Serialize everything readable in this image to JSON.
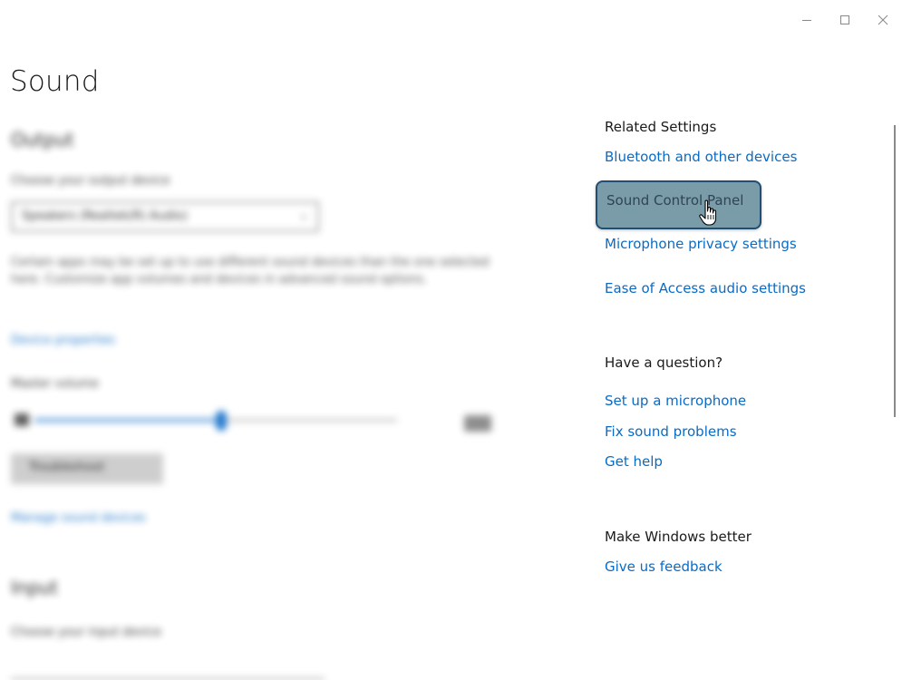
{
  "window": {
    "controls": {
      "minimize": "–",
      "maximize": "☐",
      "close": "✕"
    }
  },
  "page": {
    "title": "Sound"
  },
  "output_section": {
    "heading": "Output",
    "device_label": "Choose your output device",
    "device_value": "Speakers (Realtek(R) Audio)",
    "description": "Certain apps may be set up to use different sound devices than the one selected here. Customize app volumes and devices in advanced sound options.",
    "properties_link": "Device properties",
    "volume_label": "Master volume",
    "volume_level": 0.52,
    "volume_value": "52",
    "troubleshoot_button": "Troubleshoot",
    "manage_link": "Manage sound devices"
  },
  "input_section": {
    "heading": "Input",
    "device_label": "Choose your input device"
  },
  "related_settings": {
    "heading": "Related Settings",
    "links": [
      "Bluetooth and other devices",
      "Sound Control Panel",
      "Microphone privacy settings",
      "Ease of Access audio settings"
    ]
  },
  "have_question": {
    "heading": "Have a question?",
    "links": [
      "Set up a microphone",
      "Fix sound problems",
      "Get help"
    ]
  },
  "make_better": {
    "heading": "Make Windows better",
    "links": [
      "Give us feedback"
    ]
  },
  "colors": {
    "link": "#0a6bc4",
    "highlight_fill": "#7a9ca9",
    "highlight_border": "#1f4f74",
    "accent": "#1b74cc"
  },
  "icons": [
    "minimize-icon",
    "maximize-icon",
    "close-icon",
    "hand-pointer-icon",
    "speaker-icon"
  ]
}
